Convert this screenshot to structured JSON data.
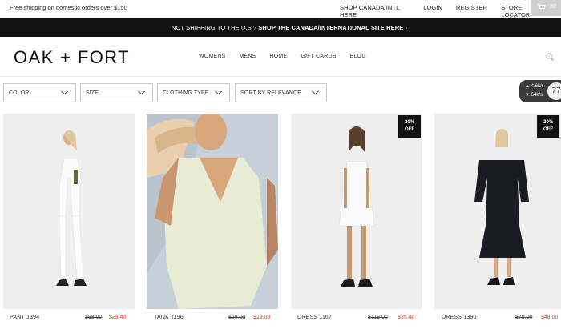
{
  "topbar": {
    "shipping_text": "Free shipping on domestic orders over $150",
    "links": [
      "SHOP CANADA/INTL HERE",
      "LOGIN",
      "REGISTER",
      "STORE LOCATOR"
    ],
    "cart_amount": "$0"
  },
  "notice": {
    "prefix": "NOT SHIPPING TO THE U.S.?",
    "cta": "SHOP THE CANADA/INTERNATIONAL SITE HERE ›"
  },
  "header": {
    "brand": "OAK + FORT",
    "nav": [
      "WOMENS",
      "MENS",
      "HOME",
      "GIFT CARDS",
      "BLOG"
    ]
  },
  "filters": [
    "COLOR",
    "SIZE",
    "CLOTHING TYPE",
    "SORT BY RELEVANCE"
  ],
  "speed_widget": {
    "up": "▲ 4.6k/s",
    "down": "▼ 64k/s",
    "value": "77"
  },
  "products": [
    {
      "name": "PANT 1394",
      "old_price": "$98.00",
      "price": "$29.40",
      "badge": ""
    },
    {
      "name": "TANK 1196",
      "old_price": "$58.00",
      "price": "$29.00",
      "badge": ""
    },
    {
      "name": "DRESS 1167",
      "old_price": "$118.00",
      "price": "$35.40",
      "badge": "20%\nOFF"
    },
    {
      "name": "DRESS 1390",
      "old_price": "$78.00",
      "price": "$48.00",
      "badge": "20%\nOFF"
    }
  ],
  "colors": {
    "sale_red": "#e03c31",
    "notice_bg": "#111111"
  }
}
